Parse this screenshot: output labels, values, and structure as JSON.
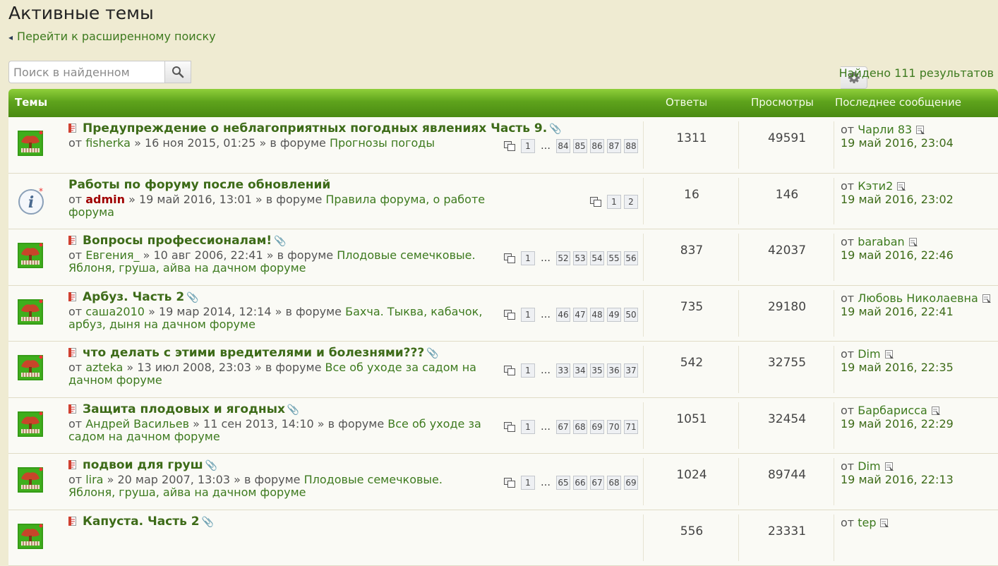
{
  "page": {
    "title": "Активные темы",
    "advanced_search": "Перейти к расширенному поиску",
    "search_placeholder": "Поиск в найденном",
    "found": "Найдено 111 результатов"
  },
  "header": {
    "topics": "Темы",
    "replies": "Ответы",
    "views": "Просмотры",
    "last_post": "Последнее сообщение"
  },
  "labels": {
    "from": "от",
    "in_forum": "» в форуме",
    "sep": "»",
    "dots": "…"
  },
  "topics": [
    {
      "title": "Предупреждение о неблагоприятных погодных явлениях Часть 9.",
      "author": "fisherka",
      "date": "16 ноя 2015, 01:25",
      "forum": "Прогнозы погоды",
      "pages": [
        "1",
        "84",
        "85",
        "86",
        "87",
        "88"
      ],
      "replies": "1311",
      "views": "49591",
      "last_author": "Чарли 83",
      "last_date": "19 май 2016, 23:04",
      "icon": "forum-tree-icon",
      "attachment": true
    },
    {
      "title": "Работы по форуму после обновлений",
      "author": "admin",
      "date": "19 май 2016, 13:01",
      "forum": "Правила форума, о работе форума",
      "pages": [
        "1",
        "2"
      ],
      "replies": "16",
      "views": "146",
      "last_author": "Кэти2",
      "last_date": "19 май 2016, 23:02",
      "icon": "info-icon",
      "attachment": false
    },
    {
      "title": "Вопросы профессионалам!",
      "author": "Евгения_",
      "date": "10 авг 2006, 22:41",
      "forum": "Плодовые семечковые. Яблоня, груша, айва на дачном форуме",
      "pages": [
        "1",
        "52",
        "53",
        "54",
        "55",
        "56"
      ],
      "replies": "837",
      "views": "42037",
      "last_author": "baraban",
      "last_date": "19 май 2016, 22:46",
      "icon": "forum-tree-icon",
      "attachment": true
    },
    {
      "title": "Арбуз. Часть 2",
      "author": "саша2010",
      "date": "19 мар 2014, 12:14",
      "forum": "Бахча. Тыква, кабачок, арбуз, дыня на дачном форуме",
      "pages": [
        "1",
        "46",
        "47",
        "48",
        "49",
        "50"
      ],
      "replies": "735",
      "views": "29180",
      "last_author": "Любовь Николаевна",
      "last_date": "19 май 2016, 22:41",
      "icon": "forum-tree-icon",
      "attachment": true
    },
    {
      "title": "что делать с этими вредителями и болезнями???",
      "author": "azteka",
      "date": "13 июл 2008, 23:03",
      "forum": "Все об уходе за садом на дачном форуме",
      "pages": [
        "1",
        "33",
        "34",
        "35",
        "36",
        "37"
      ],
      "replies": "542",
      "views": "32755",
      "last_author": "Dim",
      "last_date": "19 май 2016, 22:35",
      "icon": "forum-tree-icon",
      "attachment": true
    },
    {
      "title": "Защита плодовых и ягодных",
      "author": "Андрей Васильев",
      "date": "11 сен 2013, 14:10",
      "forum": "Все об уходе за садом на дачном форуме",
      "pages": [
        "1",
        "67",
        "68",
        "69",
        "70",
        "71"
      ],
      "replies": "1051",
      "views": "32454",
      "last_author": "Барбарисса",
      "last_date": "19 май 2016, 22:29",
      "icon": "forum-tree-icon",
      "attachment": true
    },
    {
      "title": "подвои для груш",
      "author": "lira",
      "date": "20 мар 2007, 13:03",
      "forum": "Плодовые семечковые. Яблоня, груша, айва на дачном форуме",
      "pages": [
        "1",
        "65",
        "66",
        "67",
        "68",
        "69"
      ],
      "replies": "1024",
      "views": "89744",
      "last_author": "Dim",
      "last_date": "19 май 2016, 22:13",
      "icon": "forum-tree-icon",
      "attachment": true
    },
    {
      "title": "Капуста. Часть 2",
      "author": "",
      "date": "",
      "forum": "",
      "pages": [],
      "replies": "556",
      "views": "23331",
      "last_author": "tep",
      "last_date": "",
      "icon": "forum-tree-icon",
      "attachment": true
    }
  ]
}
